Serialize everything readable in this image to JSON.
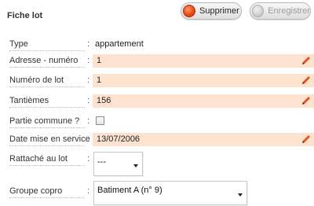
{
  "page": {
    "title": "Fiche lot"
  },
  "toolbar": {
    "delete_label": "Supprimer",
    "save_label": "Enregistrer"
  },
  "form": {
    "type": {
      "label": "Type",
      "value": "appartement"
    },
    "adresse": {
      "label": "Adresse - numéro",
      "value": "1"
    },
    "numero_lot": {
      "label": "Numéro de lot",
      "value": "1"
    },
    "tantiemes": {
      "label": "Tantièmes",
      "value": "156"
    },
    "partie_commune": {
      "label": "Partie commune ?",
      "checked": false
    },
    "date_service": {
      "label": "Date mise en service",
      "value": "13/07/2006"
    },
    "rattache": {
      "label": "Rattaché au lot",
      "selected": "---"
    },
    "groupe_copro": {
      "label": "Groupe copro",
      "selected": "Batiment A (n° 9)"
    }
  },
  "colon": ":",
  "colors": {
    "editable_bg": "#fde3cf",
    "pencil": "#e0551b",
    "delete_dot": "#e8440f"
  },
  "icons": {
    "edit": "pencil-icon",
    "dropdown": "chevron-down-icon"
  }
}
